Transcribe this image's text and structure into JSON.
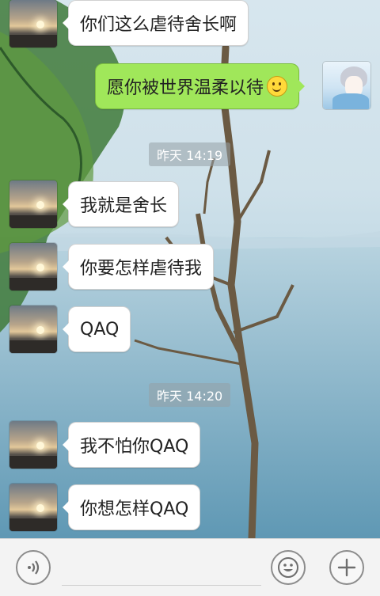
{
  "messages": [
    {
      "side": "left",
      "avatar": "sunset-avatar",
      "text": "你们这么虐待舍长啊"
    },
    {
      "side": "right",
      "avatar": "anime-avatar",
      "text": "愿你被世界温柔以待",
      "emoji": "smiley-emoji"
    },
    {
      "type": "timestamp",
      "text": "昨天 14:19"
    },
    {
      "side": "left",
      "avatar": "sunset-avatar",
      "text": "我就是舍长"
    },
    {
      "side": "left",
      "avatar": "sunset-avatar",
      "text": "你要怎样虐待我"
    },
    {
      "side": "left",
      "avatar": "sunset-avatar",
      "text": "QAQ"
    },
    {
      "type": "timestamp",
      "text": "昨天 14:20"
    },
    {
      "side": "left",
      "avatar": "sunset-avatar",
      "text": "我不怕你QAQ"
    },
    {
      "side": "left",
      "avatar": "sunset-avatar",
      "text": "你想怎样QAQ"
    }
  ],
  "input_bar": {
    "voice_icon": "voice-icon",
    "emoji_icon": "emoji-icon",
    "plus_icon": "plus-icon"
  },
  "colors": {
    "outgoing_bubble": "#a0e75a",
    "incoming_bubble": "#ffffff",
    "timestamp_bg": "#969fa5"
  }
}
